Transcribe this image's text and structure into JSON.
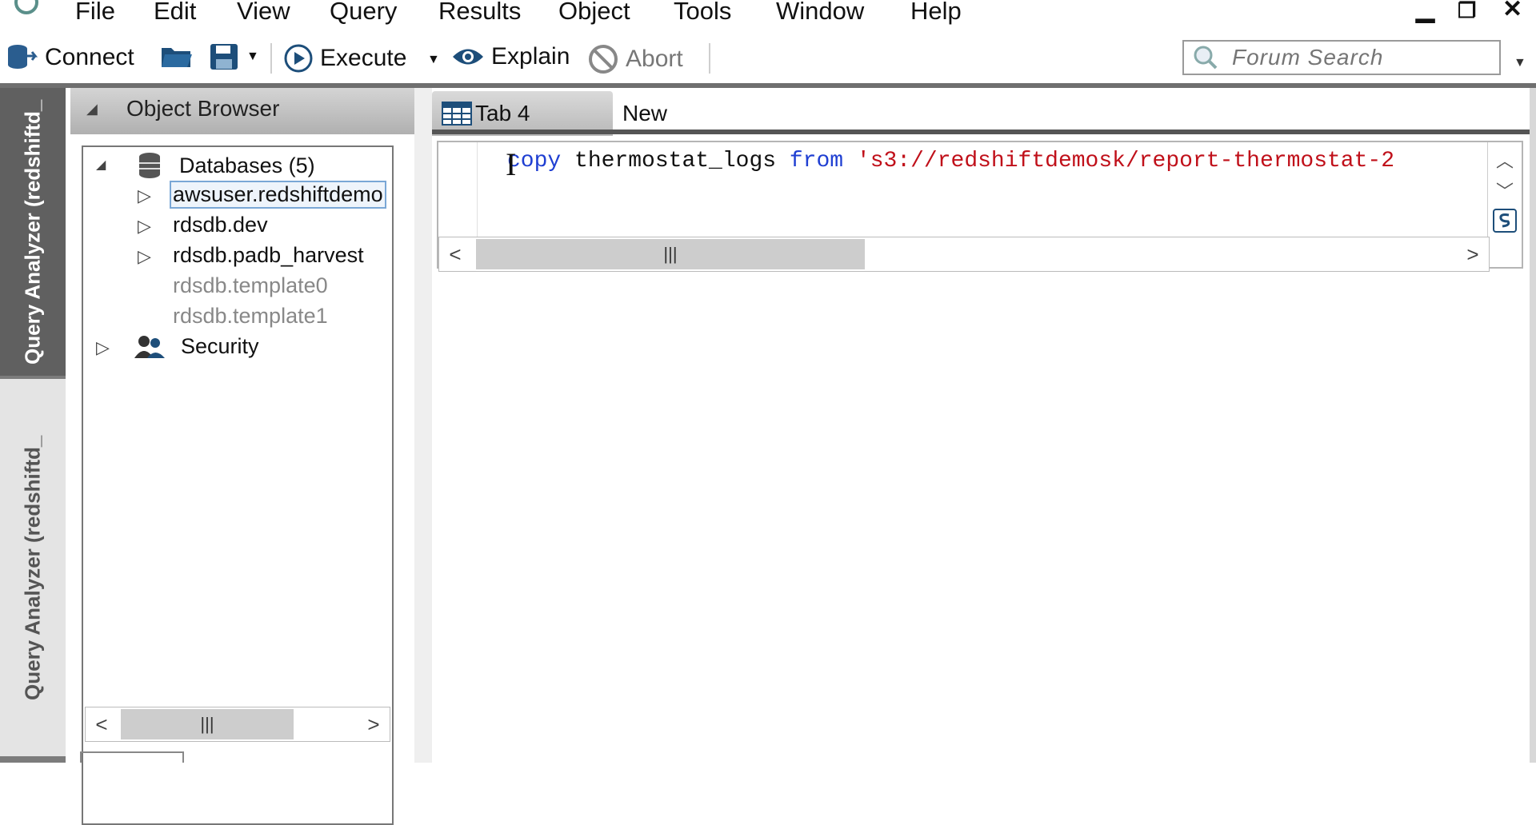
{
  "menubar": {
    "items": [
      "File",
      "Edit",
      "View",
      "Query",
      "Results",
      "Object",
      "Tools",
      "Window",
      "Help"
    ]
  },
  "toolbar": {
    "connect_label": "Connect",
    "execute_label": "Execute",
    "explain_label": "Explain",
    "abort_label": "Abort",
    "search_placeholder": "Forum Search"
  },
  "side_tabs": [
    "Query Analyzer (redshiftd_",
    "Query Analyzer (redshiftd_"
  ],
  "object_browser": {
    "title": "Object Browser",
    "tree": [
      {
        "label": "Databases (5)",
        "icon": "database-stack-icon",
        "expanded": true
      },
      {
        "label": "awsuser.redshiftdemo",
        "selected": true
      },
      {
        "label": "rdsdb.dev"
      },
      {
        "label": "rdsdb.padb_harvest"
      },
      {
        "label": "rdsdb.template0",
        "disabled": true
      },
      {
        "label": "rdsdb.template1",
        "disabled": true
      },
      {
        "label": "Security",
        "icon": "users-icon"
      }
    ]
  },
  "editor_tabs": [
    "Tab 4",
    "New"
  ],
  "editor": {
    "code_kw1": "copy",
    "code_txt1": " thermostat_logs ",
    "code_kw2": "from",
    "code_str": " 's3://redshiftdemosk/report-thermostat-2"
  },
  "colors": {
    "keyword": "#1f3fd2",
    "string": "#c0101a",
    "panel_dark": "#606060"
  }
}
